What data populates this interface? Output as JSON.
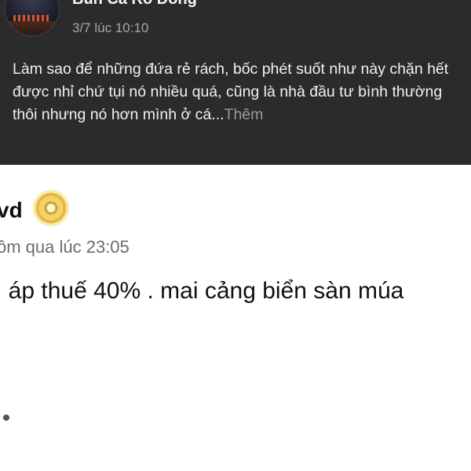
{
  "post": {
    "author": "Bún Cá Rô Đồng",
    "time": "3/7 lúc 10:10",
    "body": "Làm sao để những đứa rẻ rách, bốc phét suốt như này chặn hết được nhỉ chứ tụi nó nhiều quá, cũng là nhà đầu tư bình thường thôi nhưng nó hơn mình ở cá...",
    "see_more": "Thêm"
  },
  "comment": {
    "name": "vd",
    "time": "ôm qua lúc 23:05",
    "text": ". áp thuế 40% . mai cảng biển sàn múa"
  }
}
